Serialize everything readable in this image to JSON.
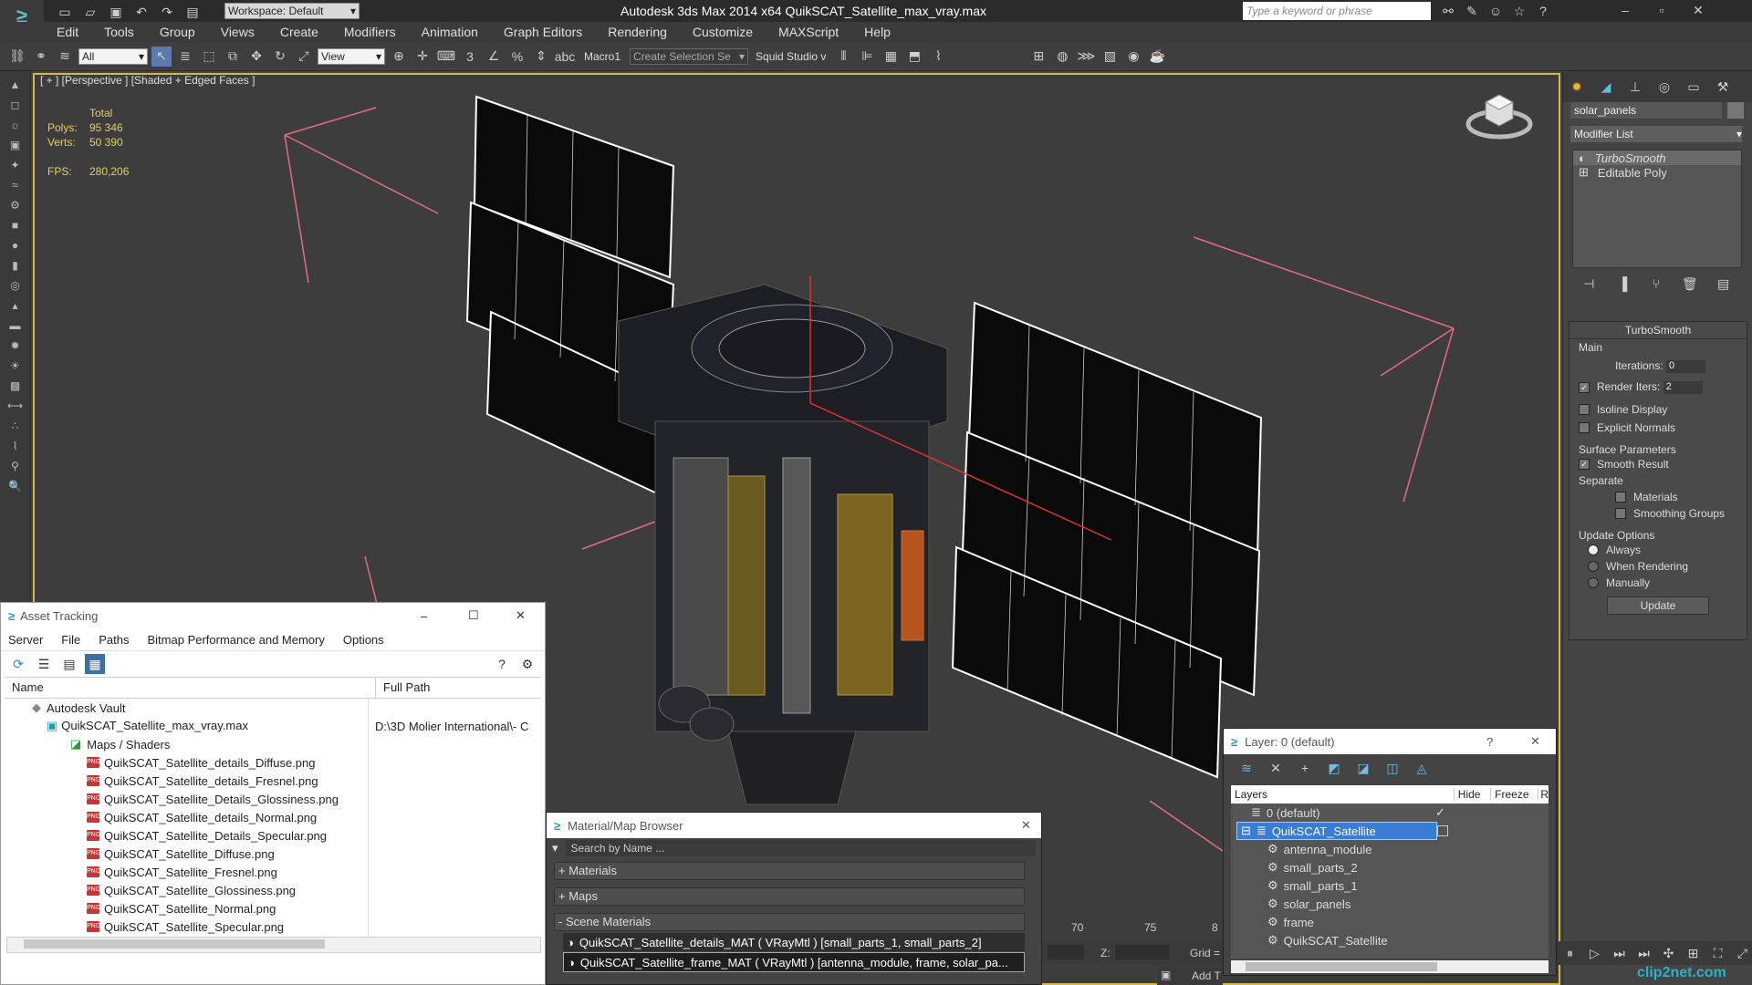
{
  "app": {
    "title": "Autodesk 3ds Max  2014 x64     QuikSCAT_Satellite_max_vray.max",
    "workspace": "Workspace: Default",
    "search_placeholder": "Type a keyword or phrase"
  },
  "menu": [
    "Edit",
    "Tools",
    "Group",
    "Views",
    "Create",
    "Modifiers",
    "Animation",
    "Graph Editors",
    "Rendering",
    "Customize",
    "MAXScript",
    "Help"
  ],
  "toolbar": {
    "filter_select": "All",
    "ref_coord_select": "View",
    "macro_label": "Macro1",
    "selection_set": "Create Selection Se",
    "studio_label": "Squid Studio v"
  },
  "viewport": {
    "label": "[ + ] [Perspective ] [Shaded + Edged Faces ]",
    "stats": {
      "total_label": "Total",
      "polys_label": "Polys:",
      "polys_value": "95 346",
      "verts_label": "Verts:",
      "verts_value": "50 390",
      "fps_label": "FPS:",
      "fps_value": "280,206"
    }
  },
  "command_panel": {
    "object_name": "solar_panels",
    "modifier_list": "Modifier List",
    "stack": [
      "TurboSmooth",
      "Editable Poly"
    ],
    "turbosmooth": {
      "title": "TurboSmooth",
      "main": "Main",
      "iterations_label": "Iterations:",
      "iterations_value": "0",
      "render_iters_label": "Render Iters:",
      "render_iters_value": "2",
      "isoline": "Isoline Display",
      "explicit_normals": "Explicit Normals",
      "surface_params": "Surface Parameters",
      "smooth_result": "Smooth Result",
      "separate": "Separate",
      "materials": "Materials",
      "smoothing_groups": "Smoothing Groups",
      "update_options": "Update Options",
      "always": "Always",
      "when_rendering": "When Rendering",
      "manually": "Manually",
      "update_button": "Update"
    }
  },
  "asset_tracking": {
    "title": "Asset Tracking",
    "menu": [
      "Server",
      "File",
      "Paths",
      "Bitmap Performance and Memory",
      "Options"
    ],
    "col_name": "Name",
    "col_path": "Full Path",
    "vault": "Autodesk Vault",
    "file": "QuikSCAT_Satellite_max_vray.max",
    "file_path": "D:\\3D Molier International\\- C",
    "maps_group": "Maps / Shaders",
    "maps": [
      "QuikSCAT_Satellite_details_Diffuse.png",
      "QuikSCAT_Satellite_details_Fresnel.png",
      "QuikSCAT_Satellite_Details_Glossiness.png",
      "QuikSCAT_Satellite_details_Normal.png",
      "QuikSCAT_Satellite_Details_Specular.png",
      "QuikSCAT_Satellite_Diffuse.png",
      "QuikSCAT_Satellite_Fresnel.png",
      "QuikSCAT_Satellite_Glossiness.png",
      "QuikSCAT_Satellite_Normal.png",
      "QuikSCAT_Satellite_Specular.png"
    ]
  },
  "material_browser": {
    "title": "Material/Map Browser",
    "search_placeholder": "Search by Name ...",
    "sections": [
      "+ Materials",
      "+ Maps",
      "- Scene Materials"
    ],
    "scene_materials": [
      "QuikSCAT_Satellite_details_MAT  ( VRayMtl )  [small_parts_1, small_parts_2]",
      "QuikSCAT_Satellite_frame_MAT  ( VRayMtl )  [antenna_module, frame, solar_pa..."
    ]
  },
  "layer_manager": {
    "title": "Layer: 0 (default)",
    "col_layers": "Layers",
    "col_hide": "Hide",
    "col_freeze": "Freeze",
    "col_r": "R",
    "layers": [
      "0 (default)",
      "QuikSCAT_Satellite"
    ],
    "objects": [
      "antenna_module",
      "small_parts_2",
      "small_parts_1",
      "solar_panels",
      "frame",
      "QuikSCAT_Satellite"
    ]
  },
  "timeline": {
    "ticks": [
      "70",
      "75",
      "8"
    ],
    "z_label": "Z:",
    "grid_label": "Grid =",
    "add_label": "Add T"
  },
  "watermark": "clip2net.com"
}
